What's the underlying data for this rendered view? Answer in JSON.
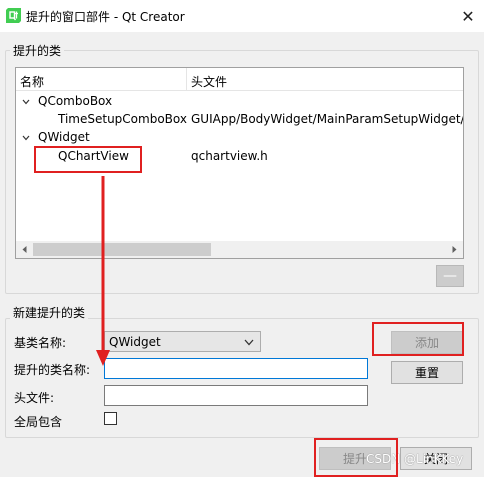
{
  "window": {
    "title": "提升的窗口部件 - Qt Creator",
    "close_glyph": "✕"
  },
  "promoted_group": {
    "title": "提升的类",
    "tree": {
      "headers": [
        "名称",
        "头文件"
      ],
      "rows": [
        {
          "name": "QComboBox",
          "header": "",
          "level": 0,
          "expanded": true
        },
        {
          "name": "TimeSetupComboBox",
          "header": "GUIApp/BodyWidget/MainParamSetupWidget/",
          "level": 1
        },
        {
          "name": "QWidget",
          "header": "",
          "level": 0,
          "expanded": true
        },
        {
          "name": "QChartView",
          "header": "qchartview.h",
          "level": 1
        }
      ]
    },
    "remove_button_label": "—"
  },
  "new_group": {
    "title": "新建提升的类",
    "base_class_label": "基类名称:",
    "base_class_value": "QWidget",
    "class_name_label": "提升的类名称:",
    "class_name_value": "",
    "header_file_label": "头文件:",
    "header_file_value": "",
    "global_include_label": "全局包含",
    "global_include_checked": false,
    "add_button_label": "添加",
    "reset_button_label": "重置"
  },
  "footer": {
    "promote_button_label": "提升",
    "close_button_label": "关闭",
    "watermark": "CSDN @LinKKey"
  },
  "colors": {
    "annotation_red": "#e02020",
    "focus_blue": "#0078d7",
    "icon_green": "#41cd52"
  },
  "icons": {
    "app": "qt-creator-logo-icon",
    "expand": "chevron-down-icon",
    "scroll_left": "triangle-left-icon",
    "scroll_right": "triangle-right-icon",
    "combo": "chevron-down-icon"
  }
}
